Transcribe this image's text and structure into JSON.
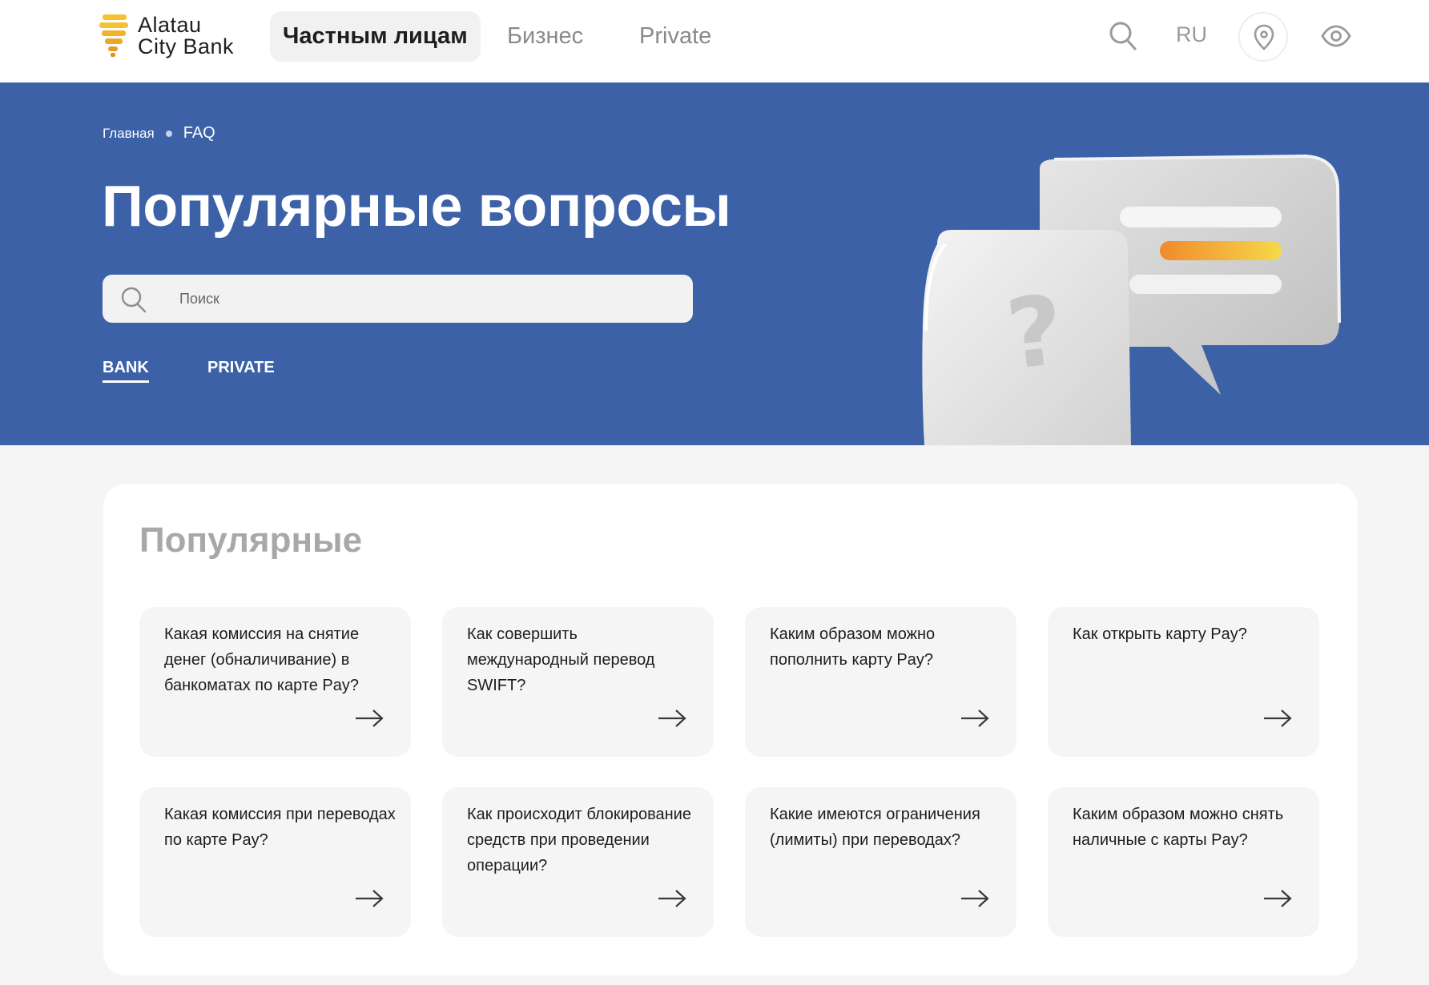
{
  "header": {
    "logo": {
      "line1": "Alatau",
      "line2": "City Bank"
    },
    "nav": [
      {
        "label": "Частным лицам",
        "active": true
      },
      {
        "label": "Бизнес",
        "active": false
      },
      {
        "label": "Private",
        "active": false
      }
    ],
    "language": "RU",
    "icons": [
      "search-icon",
      "location-pin-icon",
      "eye-icon"
    ]
  },
  "hero": {
    "breadcrumb": {
      "home": "Главная",
      "current": "FAQ"
    },
    "title": "Популярные вопросы",
    "search": {
      "placeholder": "Поиск",
      "value": ""
    },
    "tabs": [
      {
        "label": "BANK",
        "active": true
      },
      {
        "label": "PRIVATE",
        "active": false
      }
    ],
    "colors": {
      "background": "#3c61a7"
    }
  },
  "popular": {
    "title": "Популярные",
    "questions": [
      "Какая комиссия на снятие денег (обналичивание) в банкоматах по карте Pay?",
      "Как совершить международный перевод SWIFT?",
      "Каким образом можно пополнить карту Pay?",
      "Как открыть карту Pay?",
      "Какая комиссия при переводах по карте Pay?",
      "Как происходит блокирование средств при проведении операции?",
      "Какие имеются ограничения (лимиты) при переводах?",
      "Каким образом можно снять наличные с карты Pay?"
    ]
  }
}
